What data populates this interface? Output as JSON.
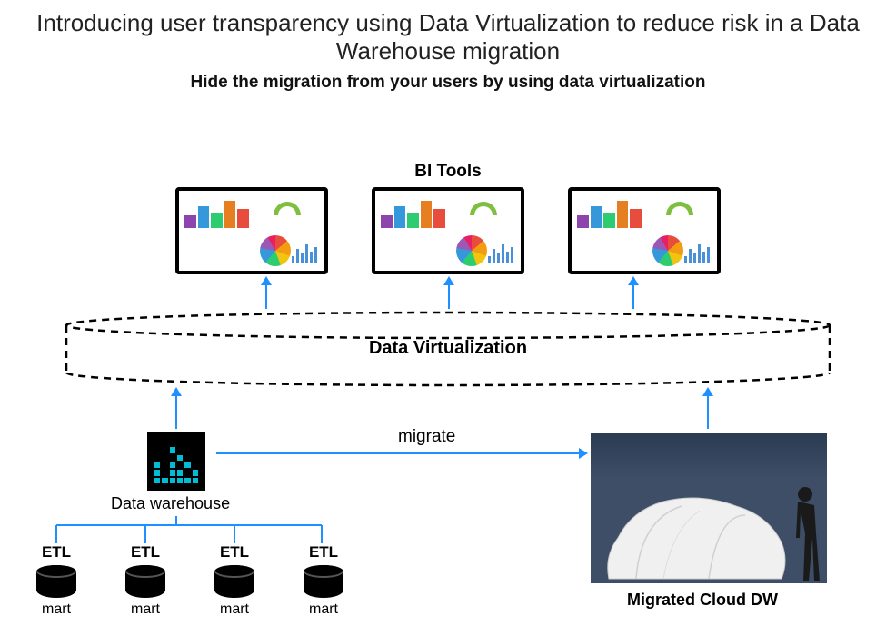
{
  "title": "Introducing user transparency using Data Virtualization to reduce risk in a Data Warehouse migration",
  "subtitle": "Hide the migration from your users by using data virtualization",
  "bi_label": "BI Tools",
  "dv_label": "Data Virtualization",
  "dw_label": "Data warehouse",
  "migrate_label": "migrate",
  "cloud_label": "Migrated Cloud DW",
  "etl": {
    "label": "ETL",
    "mart": "mart",
    "count": 4
  }
}
